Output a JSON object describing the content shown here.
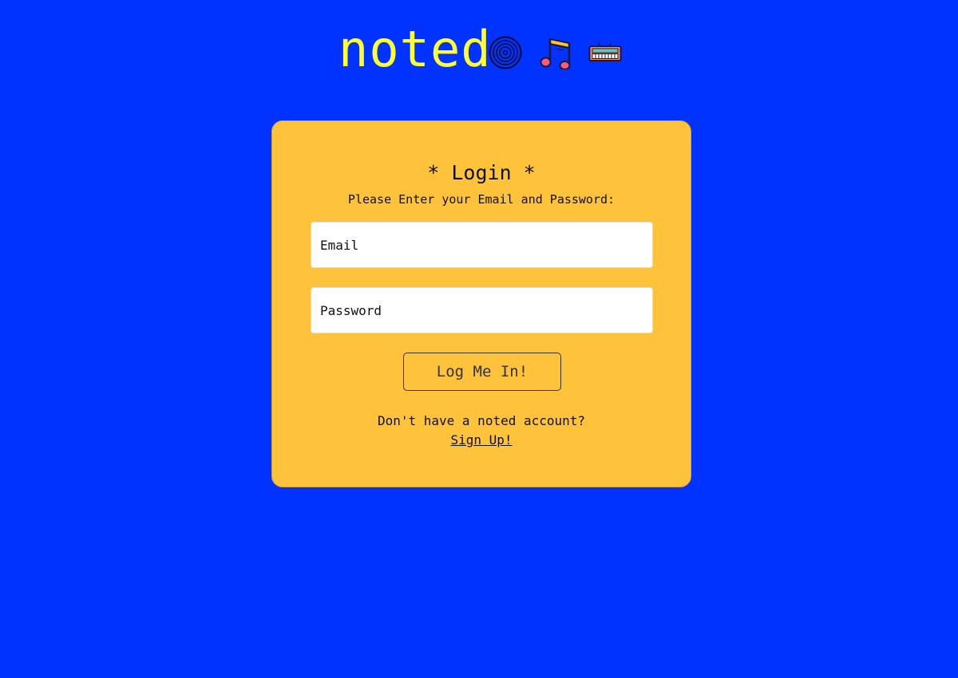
{
  "header": {
    "logo": "noted",
    "icons": [
      "vinyl-record-icon",
      "music-note-icon",
      "radio-icon"
    ]
  },
  "login": {
    "title": "* Login *",
    "subtitle": "Please Enter your Email and Password:",
    "email_placeholder": "Email",
    "password_placeholder": "Password",
    "submit_label": "Log Me In!",
    "signup_prompt": "Don't have a noted account?",
    "signup_link": "Sign Up!"
  },
  "colors": {
    "background": "#0033ff",
    "logo": "#ffff33",
    "card": "#ffc23b"
  }
}
